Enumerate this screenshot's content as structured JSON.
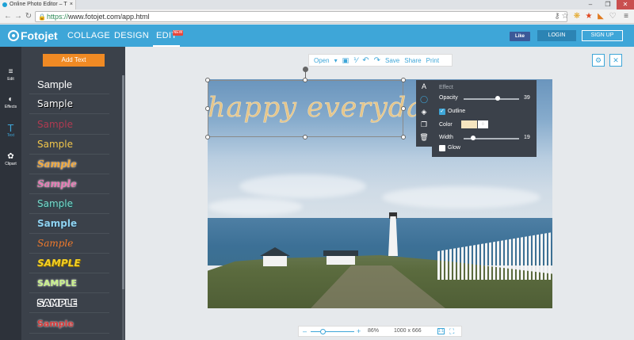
{
  "browser": {
    "tab_title": "Online Photo Editor – T",
    "tab_close": "×",
    "win_min": "–",
    "win_max": "❐",
    "win_close": "✕",
    "url_scheme": "https://",
    "url_rest": "www.fotojet.com/app.html",
    "back": "←",
    "forward": "→",
    "reload": "↻",
    "lock": "🔒",
    "ext_icons": [
      "⚷",
      "☆",
      "❋",
      "★",
      "◣",
      "♡",
      "≡"
    ]
  },
  "header": {
    "logo": "Fotojet",
    "nav": [
      "COLLAGE",
      "DESIGN",
      "EDIT"
    ],
    "new_badge": "NEW",
    "fb_like": "Like",
    "login": "LOGIN",
    "signup": "SIGN UP"
  },
  "rail": {
    "items": [
      {
        "icon": "≡",
        "label": "Edit"
      },
      {
        "icon": "◐",
        "label": "Effects"
      },
      {
        "icon": "T",
        "label": "Text"
      },
      {
        "icon": "✿",
        "label": "Clipart"
      }
    ]
  },
  "panel": {
    "add_text": "Add Text",
    "samples": [
      "Sample",
      "Sample",
      "Sample",
      "Sample",
      "Sample",
      "Sample",
      "Sample",
      "Sample",
      "Sample",
      "SAMPLE",
      "SAMPLE",
      "SAMPLE",
      "Sample"
    ]
  },
  "toolbar": {
    "open": "Open",
    "dropdown": "▾",
    "image": "▣",
    "percent": "⅟",
    "undo": "↶",
    "redo": "↷",
    "save": "Save",
    "share": "Share",
    "print": "Print",
    "settings": "⚙",
    "close": "✕"
  },
  "canvas": {
    "text": "happy everyday"
  },
  "sidetools": [
    "A",
    "◯",
    "◈",
    "❐",
    "🗑"
  ],
  "effect": {
    "title": "Effect",
    "opacity_label": "Opacity",
    "opacity_value": "39",
    "opacity": 0.39,
    "outline_label": "Outline",
    "outline_check": "✓",
    "color_label": "Color",
    "picker": "◌",
    "width_label": "Width",
    "width_value": "19",
    "glow_label": "Glow"
  },
  "zoom": {
    "minus": "–",
    "plus": "+",
    "percent": "86%",
    "dims": "1000 x 666",
    "one_to_one": "1:1",
    "fit": "⛶"
  }
}
